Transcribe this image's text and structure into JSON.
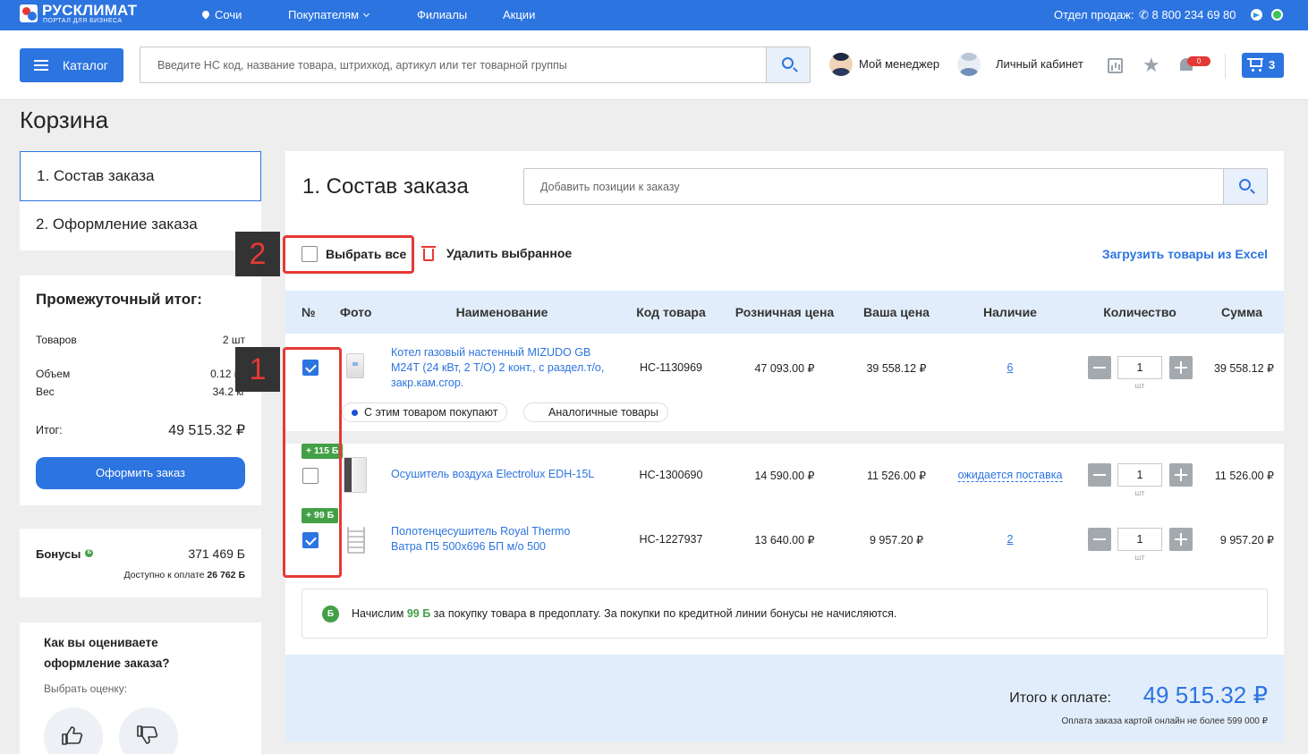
{
  "topbar": {
    "logo_text": "РУСКЛИМАТ",
    "logo_sub": "ПОРТАЛ ДЛЯ БИЗНЕСА",
    "city": "Сочи",
    "nav": [
      "Покупателям",
      "Филиалы",
      "Акции"
    ],
    "sales_label": "Отдел продаж:",
    "phone": "8 800 234 69 80"
  },
  "header": {
    "catalog_label": "Каталог",
    "search_placeholder": "Введите НС код, название товара, штрихкод, артикул или тег товарной группы",
    "manager_label": "Мой менеджер",
    "account_label": "Личный кабинет",
    "notifications_count": "0",
    "cart_count": "3"
  },
  "page_title": "Корзина",
  "steps": [
    "1. Состав заказа",
    "2. Оформление заказа"
  ],
  "summary": {
    "title": "Промежуточный итог:",
    "goods_label": "Товаров",
    "goods_value": "2 шт",
    "volume_label": "Объем",
    "volume_value": "0.12 м³",
    "weight_label": "Вес",
    "weight_value": "34.2 кг",
    "total_label": "Итог:",
    "total_value": "49 515.32 ₽",
    "order_button": "Оформить заказ"
  },
  "bonuses": {
    "label": "Бонусы",
    "badge": "Б",
    "value": "371 469 Б",
    "available_label": "Доступно к оплате",
    "available_value": "26 762 Б"
  },
  "rating": {
    "title": "Как вы оцениваете оформление заказа?",
    "subtitle": "Выбрать оценку:"
  },
  "main": {
    "title": "1. Состав заказа",
    "add_placeholder": "Добавить позиции к заказу",
    "select_all": "Выбрать все",
    "delete_selected": "Удалить выбранное",
    "excel_link": "Загрузить товары из Excel",
    "columns": [
      "№",
      "Фото",
      "Наименование",
      "Код товара",
      "Розничная цена",
      "Ваша цена",
      "Наличие",
      "Количество",
      "Сумма"
    ],
    "rows": [
      {
        "checked": true,
        "name": "Котел газовый настенный MIZUDO GB М24Т (24 кВт, 2 Т/О) 2 конт., с раздел.т/о, закр.кам.сгор.",
        "code": "НС-1130969",
        "retail": "47 093.00 ₽",
        "price": "39 558.12 ₽",
        "availability": "6",
        "qty": "1",
        "unit": "шт",
        "sum": "39 558.12 ₽",
        "pill_1": "С этим товаром покупают",
        "pill_2": "Аналогичные товары"
      },
      {
        "checked": false,
        "bonus": "+ 115 Б",
        "name": "Осушитель воздуха Electrolux EDH-15L",
        "code": "НС-1300690",
        "retail": "14 590.00 ₽",
        "price": "11 526.00 ₽",
        "availability": "ожидается поставка",
        "qty": "1",
        "unit": "шт",
        "sum": "11 526.00 ₽"
      },
      {
        "checked": true,
        "bonus": "+ 99 Б",
        "name": "Полотенцесушитель Royal Thermo Ватра П5 500х696 БП м/о 500",
        "code": "НС-1227937",
        "retail": "13 640.00 ₽",
        "price": "9 957.20 ₽",
        "availability": "2",
        "qty": "1",
        "unit": "шт",
        "sum": "9 957.20 ₽"
      }
    ],
    "notice": {
      "badge": "Б",
      "pre": "Начислим",
      "amount": "99 Б",
      "post": "за покупку товара в предоплату. За покупки по кредитной линии бонусы не начисляются."
    },
    "total_label": "Итого к оплате:",
    "total_value": "49 515.32 ₽",
    "total_note": "Оплата заказа картой онлайн не более 599 000 ₽"
  },
  "annotations": [
    "1",
    "2"
  ],
  "colors": {
    "accent": "#2c74e0",
    "annotation": "#e53935",
    "bonus": "#43a047"
  }
}
